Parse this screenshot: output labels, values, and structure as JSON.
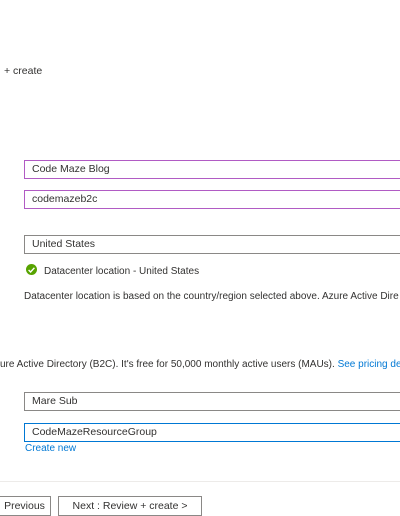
{
  "breadcrumb": {
    "text": "+ create"
  },
  "form": {
    "org_name": "Code Maze Blog",
    "domain_name": "codemazeb2c",
    "country": "United States",
    "datacenter_status": "Datacenter location - United States",
    "datacenter_note": "Datacenter location is based on the country/region selected above. Azure Active Dire",
    "pricing_text": "ure Active Directory (B2C). It's free for 50,000 monthly active users (MAUs).",
    "pricing_link": "See pricing deta",
    "subscription": "Mare Sub",
    "resource_group": "CodeMazeResourceGroup",
    "create_new": "Create new"
  },
  "footer": {
    "previous_label": "Previous",
    "next_label": "Next : Review + create >"
  },
  "colors": {
    "accent": "#0078d4",
    "focused_border": "#b15bc4",
    "success": "#57a300"
  },
  "icons": {
    "status": "check-circle-icon"
  }
}
